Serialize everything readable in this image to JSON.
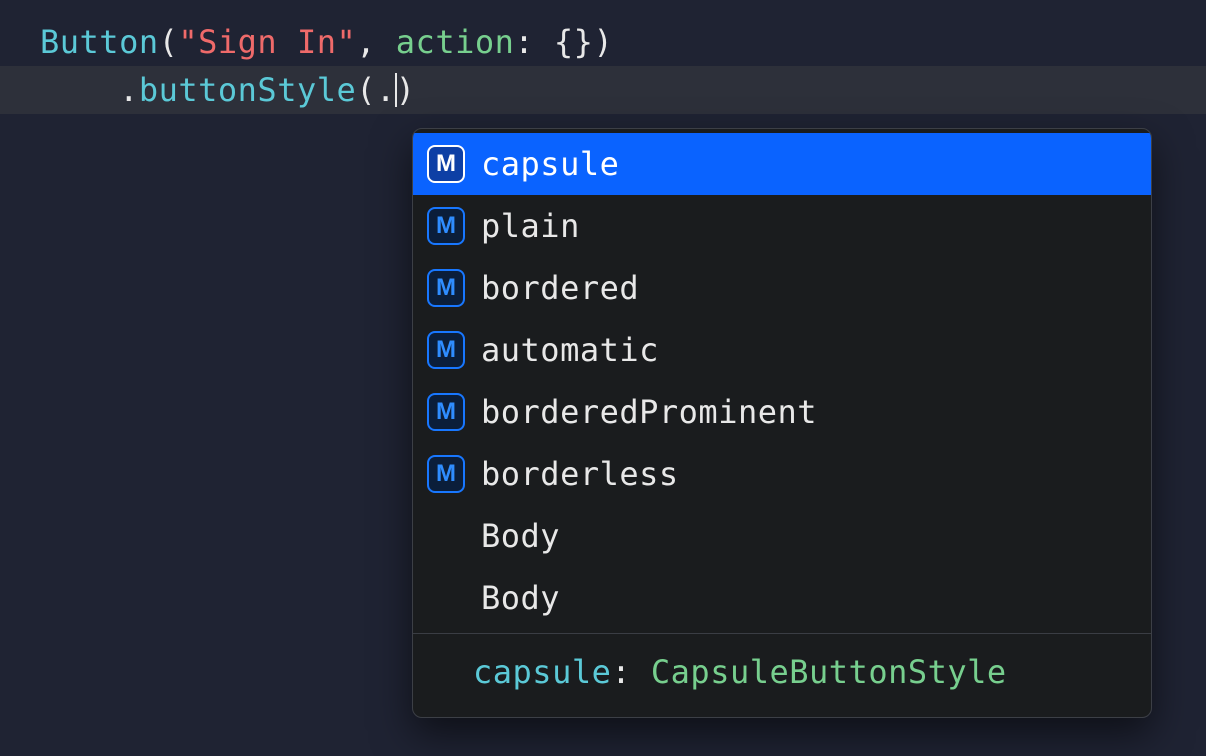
{
  "code": {
    "line1": {
      "type": "Button",
      "paren_open": "(",
      "string": "\"Sign In\"",
      "comma": ", ",
      "param": "action",
      "colon": ": ",
      "braces": "{}",
      "paren_close": ")"
    },
    "line2": {
      "indent": "    ",
      "dot": ".",
      "modifier": "buttonStyle",
      "paren_open": "(",
      "member_dot": ".",
      "paren_close": ")"
    }
  },
  "completion": {
    "selected_index": 0,
    "icon_glyph": "M",
    "items": [
      {
        "label": "capsule",
        "kind": "method"
      },
      {
        "label": "plain",
        "kind": "method"
      },
      {
        "label": "bordered",
        "kind": "method"
      },
      {
        "label": "automatic",
        "kind": "method"
      },
      {
        "label": "borderedProminent",
        "kind": "method"
      },
      {
        "label": "borderless",
        "kind": "method"
      },
      {
        "label": "Body",
        "kind": "none"
      },
      {
        "label": "Body",
        "kind": "none"
      }
    ],
    "detail": {
      "name": "capsule",
      "colon": ": ",
      "type": "CapsuleButtonStyle"
    }
  }
}
